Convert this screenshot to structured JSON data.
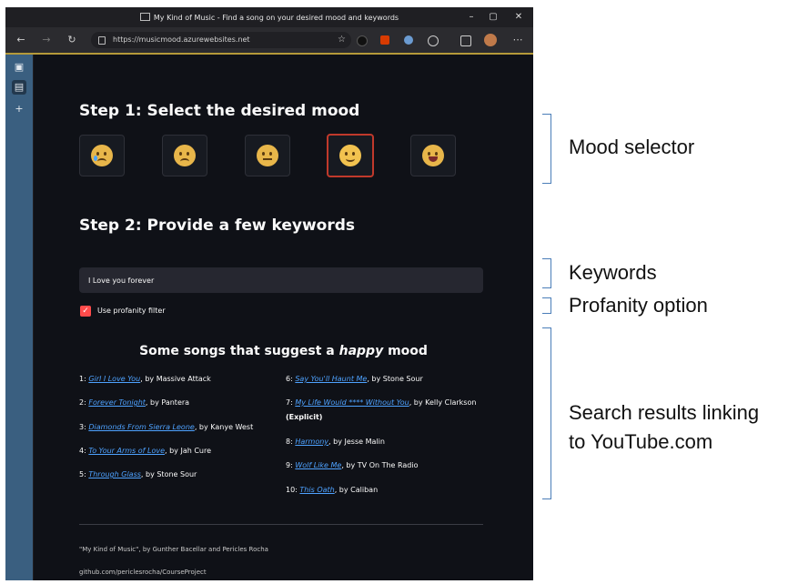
{
  "browser": {
    "window_title": "My Kind of Music - Find a song on your desired mood and keywords",
    "url": "https://musicmood.azurewebsites.net"
  },
  "page": {
    "step1_title": "Step 1: Select the desired mood",
    "moods": [
      {
        "icon": "very-sad-face-icon",
        "selected": false
      },
      {
        "icon": "sad-face-icon",
        "selected": false
      },
      {
        "icon": "neutral-face-icon",
        "selected": false
      },
      {
        "icon": "happy-face-icon",
        "selected": true
      },
      {
        "icon": "very-happy-face-icon",
        "selected": false
      }
    ],
    "step2_title": "Step 2: Provide a few keywords",
    "keywords_value": "I Love you forever",
    "profanity_label": "Use profanity filter",
    "profanity_checked": true,
    "results_prefix": "Some songs that suggest a",
    "results_mood": "happy",
    "results_suffix": "mood",
    "songs": [
      {
        "num": "1:",
        "title": "Girl I Love You",
        "artist": ", by Massive Attack"
      },
      {
        "num": "2:",
        "title": "Forever Tonight",
        "artist": ", by Pantera"
      },
      {
        "num": "3:",
        "title": "Diamonds From Sierra Leone",
        "artist": ", by Kanye West"
      },
      {
        "num": "4:",
        "title": "To Your Arms of Love",
        "artist": ", by Jah Cure"
      },
      {
        "num": "5:",
        "title": "Through Glass",
        "artist": ", by Stone Sour"
      },
      {
        "num": "6:",
        "title": "Say You'll Haunt Me",
        "artist": ", by Stone Sour"
      },
      {
        "num": "7:",
        "title": "My Life Would **** Without You",
        "artist": ", by Kelly Clarkson",
        "note": "(Explicit)"
      },
      {
        "num": "8:",
        "title": "Harmony",
        "artist": ", by Jesse Malin"
      },
      {
        "num": "9:",
        "title": "Wolf Like Me",
        "artist": ", by TV On The Radio"
      },
      {
        "num": "10:",
        "title": "This Oath",
        "artist": ", by Caliban"
      }
    ],
    "footer_credit": "\"My Kind of Music\", by Gunther Bacellar and Pericles Rocha",
    "footer_repo": "github.com/periclesrocha/CourseProject"
  },
  "annotations": {
    "mood_selector": "Mood selector",
    "keywords": "Keywords",
    "profanity": "Profanity option",
    "results_line1": "Search results linking",
    "results_line2": "to YouTube.com"
  },
  "colors": {
    "selected_border": "#c0392b",
    "checkbox": "#ff4b4b",
    "link": "#4ea2ff",
    "bracket": "#4a7db8"
  }
}
